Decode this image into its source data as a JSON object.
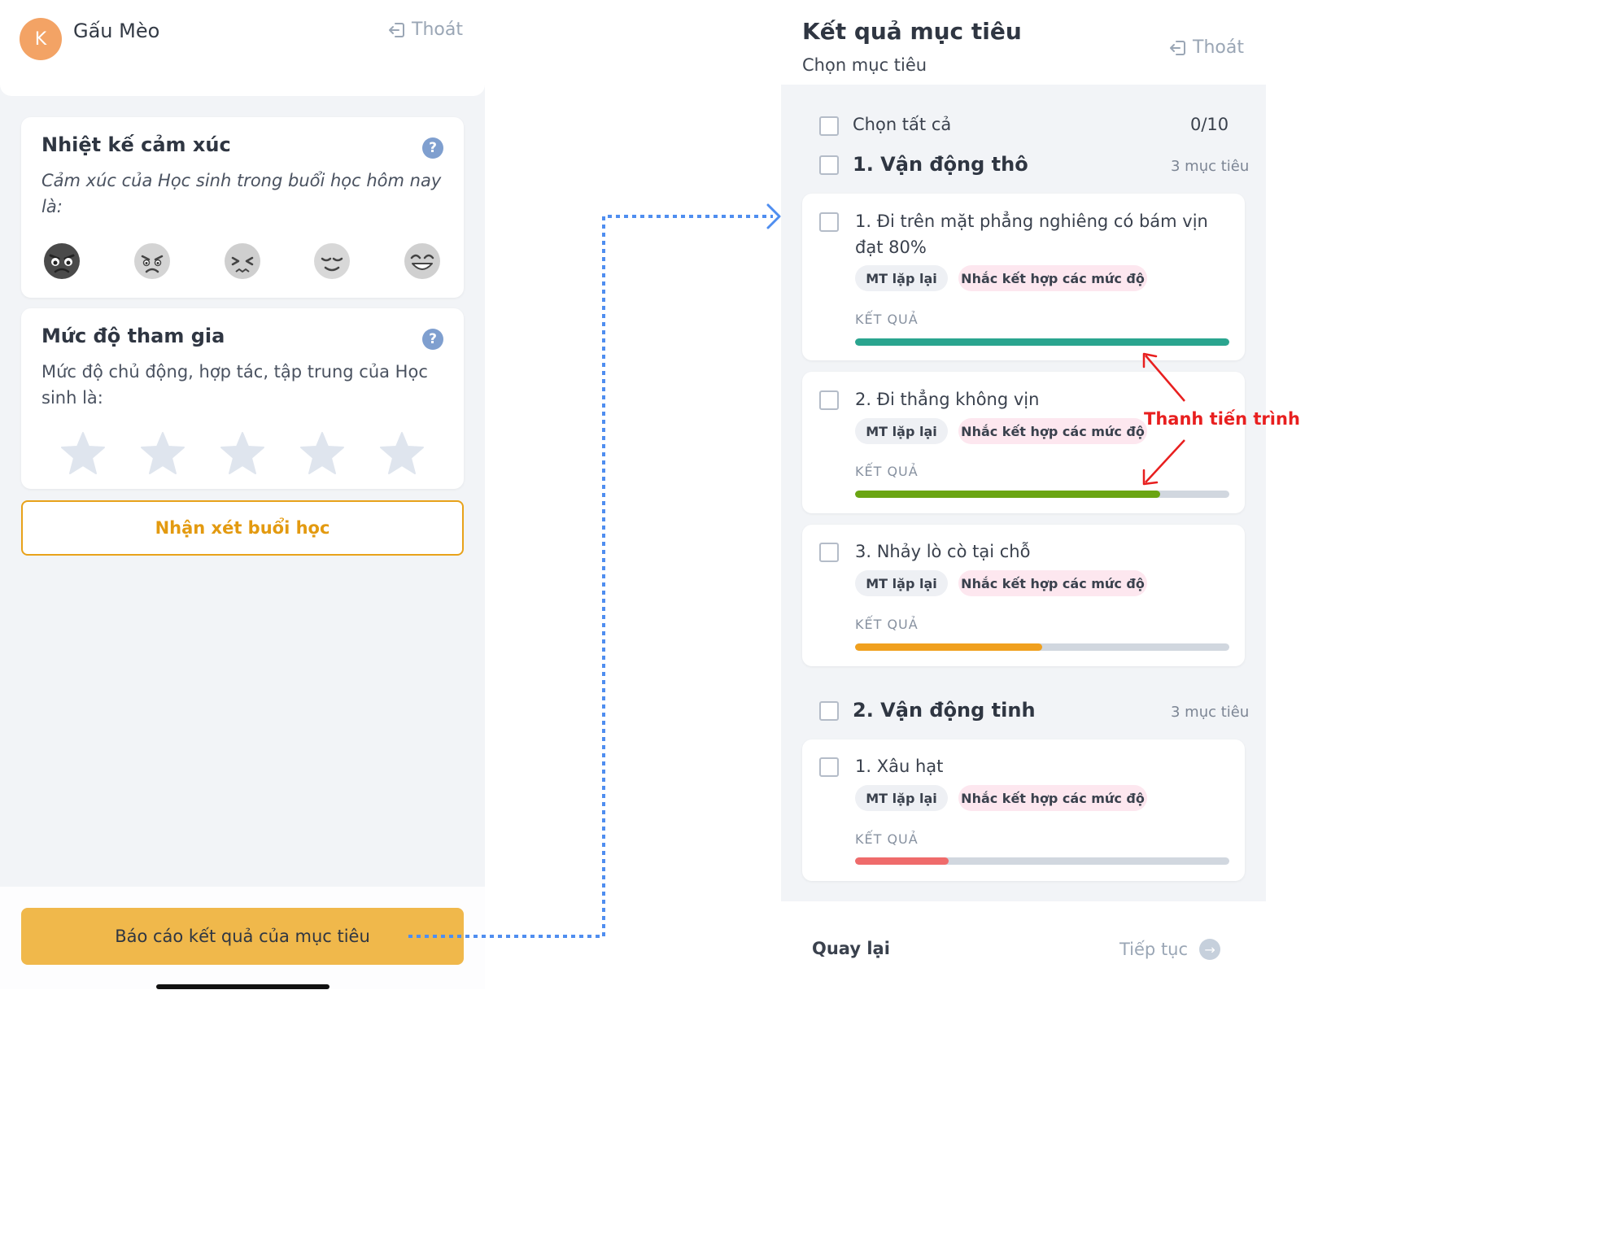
{
  "left": {
    "user": {
      "initial": "K",
      "name": "Gấu Mèo"
    },
    "logout_label": "Thoát",
    "emotion": {
      "title": "Nhiệt kế cảm xúc",
      "help": "?",
      "subtitle": "Cảm xúc của Học sinh trong buổi học hôm nay là:",
      "faces": [
        "angry-face-icon",
        "frowning-face-icon",
        "distressed-face-icon",
        "calm-face-icon",
        "grinning-face-icon"
      ]
    },
    "participation": {
      "title": "Mức độ tham gia",
      "help": "?",
      "subtitle": "Mức độ chủ động, hợp tác, tập trung của Học sinh là:",
      "stars_selected": 0,
      "stars_total": 5
    },
    "comment_button": "Nhận xét buổi học",
    "report_button": "Báo cáo kết quả của mục tiêu"
  },
  "right": {
    "title": "Kết quả mục tiêu",
    "subtitle": "Chọn mục tiêu",
    "logout_label": "Thoát",
    "select_all": {
      "label": "Chọn tất cả",
      "count": "0/10"
    },
    "sections": [
      {
        "title": "1. Vận động thô",
        "count": "3 mục tiêu",
        "goals": [
          {
            "title": "1. Đi trên mặt phẳng nghiêng có bám vịn đạt 80%",
            "tags": [
              "MT lặp lại",
              "Nhắc kết hợp các mức độ"
            ],
            "result_label": "KẾT QUẢ",
            "progress": 1.0,
            "color": "#2aa58f"
          },
          {
            "title": "2. Đi thẳng không vịn",
            "tags": [
              "MT lặp lại",
              "Nhắc kết hợp các mức độ"
            ],
            "result_label": "KẾT QUẢ",
            "progress": 0.815,
            "color": "#6aa512"
          },
          {
            "title": "3. Nhảy lò cò tại chỗ",
            "tags": [
              "MT lặp lại",
              "Nhắc kết hợp các mức độ"
            ],
            "result_label": "KẾT QUẢ",
            "progress": 0.5,
            "color": "#f0a01e"
          }
        ]
      },
      {
        "title": "2. Vận động tinh",
        "count": "3 mục tiêu",
        "goals": [
          {
            "title": "1. Xâu hạt",
            "tags": [
              "MT lặp lại",
              "Nhắc kết hợp các mức độ"
            ],
            "result_label": "KẾT QUẢ",
            "progress": 0.25,
            "color": "#ef6b6b"
          }
        ]
      }
    ],
    "annotation": "Thanh tiến trình",
    "back_button": "Quay lại",
    "next_button": "Tiếp tục"
  }
}
